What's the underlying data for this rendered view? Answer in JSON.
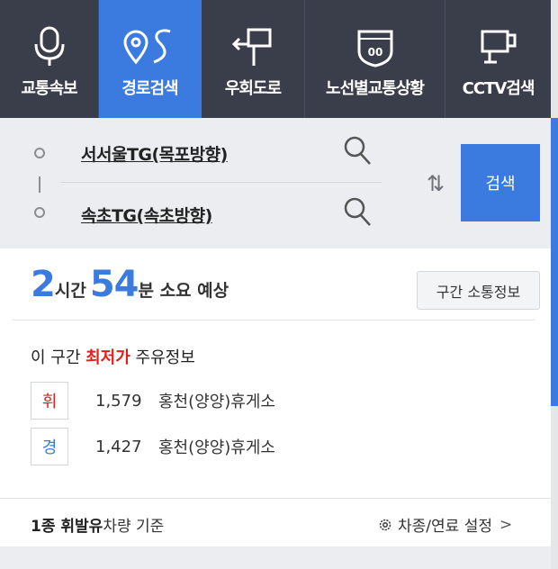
{
  "nav": {
    "tabs": [
      {
        "label": "교통속보",
        "icon": "microphone-icon"
      },
      {
        "label": "경로검색",
        "icon": "route-icon"
      },
      {
        "label": "우회도로",
        "icon": "detour-sign-icon"
      },
      {
        "label": "노선별교통상황",
        "icon": "highway-shield-icon"
      },
      {
        "label": "CCTV검색",
        "icon": "cctv-camera-icon"
      }
    ],
    "highway_number": "00",
    "active_color": "#3b7be0",
    "bg_color": "#3a3d4a"
  },
  "search": {
    "origin": "서서울TG(목포방향)",
    "destination": "속초TG(속초방향)",
    "swap_symbol": "⇅",
    "button_label": "검색"
  },
  "result": {
    "hours": "2",
    "hours_unit": "시간",
    "minutes": "54",
    "minutes_suffix": "분 소요 예상",
    "section_button": "구간 소통정보"
  },
  "fuel": {
    "title_prefix": "이 구간 ",
    "title_highlight": "최저가",
    "title_suffix": " 주유정보",
    "rows": [
      {
        "badge": "휘",
        "price": "1,579",
        "station": "홍천(양양)휴게소"
      },
      {
        "badge": "경",
        "price": "1,427",
        "station": "홍천(양양)휴게소"
      }
    ]
  },
  "footer": {
    "basis_bold": "1종 휘발유",
    "basis_rest": "차량 기준",
    "settings_label": "차종/연료 설정",
    "chevron": ">"
  }
}
